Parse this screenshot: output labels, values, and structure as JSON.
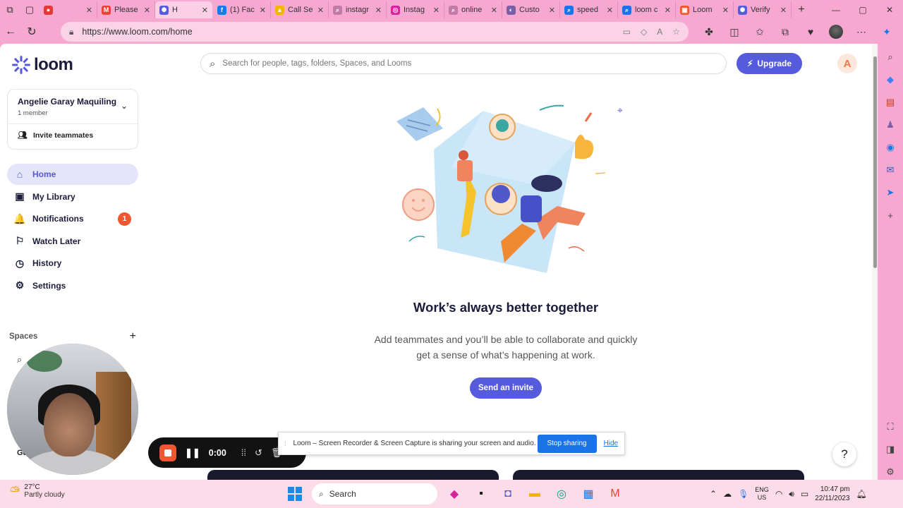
{
  "browser": {
    "tabs": [
      {
        "title": "",
        "favicon_color": "#e53935",
        "favicon_glyph": "●",
        "active": false
      },
      {
        "title": "Please",
        "favicon_color": "#ea4335",
        "favicon_glyph": "M",
        "active": false
      },
      {
        "title": "H",
        "favicon_color": "#565add",
        "favicon_glyph": "✺",
        "active": true
      },
      {
        "title": "(1) Fac",
        "favicon_color": "#1877f2",
        "favicon_glyph": "f",
        "active": false
      },
      {
        "title": "Call Se",
        "favicon_color": "#f4b400",
        "favicon_glyph": "▲",
        "active": false
      },
      {
        "title": "instagr",
        "favicon_color": "#c27aa6",
        "favicon_glyph": "⌕",
        "active": false
      },
      {
        "title": "Instag",
        "favicon_color": "#d6249f",
        "favicon_glyph": "◎",
        "active": false
      },
      {
        "title": "online",
        "favicon_color": "#c27aa6",
        "favicon_glyph": "⌕",
        "active": false
      },
      {
        "title": "Custo",
        "favicon_color": "#7b5ea7",
        "favicon_glyph": "◐",
        "active": false
      },
      {
        "title": "speed",
        "favicon_color": "#1a73e8",
        "favicon_glyph": "⌕",
        "active": false
      },
      {
        "title": "loom c",
        "favicon_color": "#1a73e8",
        "favicon_glyph": "⌕",
        "active": false
      },
      {
        "title": "Loom",
        "favicon_color": "#f05a28",
        "favicon_glyph": "▣",
        "active": false
      },
      {
        "title": "Verify",
        "favicon_color": "#565add",
        "favicon_glyph": "✺",
        "active": false
      }
    ],
    "url": "https://www.loom.com/home"
  },
  "sidebar": {
    "logo_text": "loom",
    "workspace": {
      "name": "Angelie Garay Maquiling",
      "members": "1 member",
      "invite_label": "Invite teammates"
    },
    "nav": [
      {
        "label": "Home",
        "icon": "home-icon",
        "glyph": "⌂",
        "active": true
      },
      {
        "label": "My Library",
        "icon": "library-icon",
        "glyph": "▣",
        "active": false
      },
      {
        "label": "Notifications",
        "icon": "bell-icon",
        "glyph": "🔔",
        "active": false,
        "badge": "1"
      },
      {
        "label": "Watch Later",
        "icon": "bookmark-icon",
        "glyph": "⚐",
        "active": false
      },
      {
        "label": "History",
        "icon": "clock-icon",
        "glyph": "◷",
        "active": false
      },
      {
        "label": "Settings",
        "icon": "gear-icon",
        "glyph": "⚙",
        "active": false
      }
    ],
    "spaces_label": "Spaces",
    "bottom_label": "Ge"
  },
  "main": {
    "search_placeholder": "Search for people, tags, folders, Spaces, and Looms",
    "upgrade_label": "Upgrade",
    "avatar_initial": "A",
    "headline": "Work’s always better together",
    "subtext_line1": "Add teammates and you’ll be able to collaborate and quickly",
    "subtext_line2": "get a sense of what’s happening at work.",
    "invite_button": "Send an invite"
  },
  "recorder": {
    "timer": "0:00"
  },
  "share_notice": {
    "message": "Loom – Screen Recorder & Screen Capture is sharing your screen and audio.",
    "stop_label": "Stop sharing",
    "hide_label": "Hide"
  },
  "taskbar": {
    "weather_temp": "27°C",
    "weather_desc": "Partly cloudy",
    "search_label": "Search",
    "lang_line1": "ENG",
    "lang_line2": "US",
    "time": "10:47 pm",
    "date": "22/11/2023"
  },
  "colors": {
    "accent": "#565add",
    "badge": "#f0562f",
    "chrome": "#f7a8d0"
  }
}
